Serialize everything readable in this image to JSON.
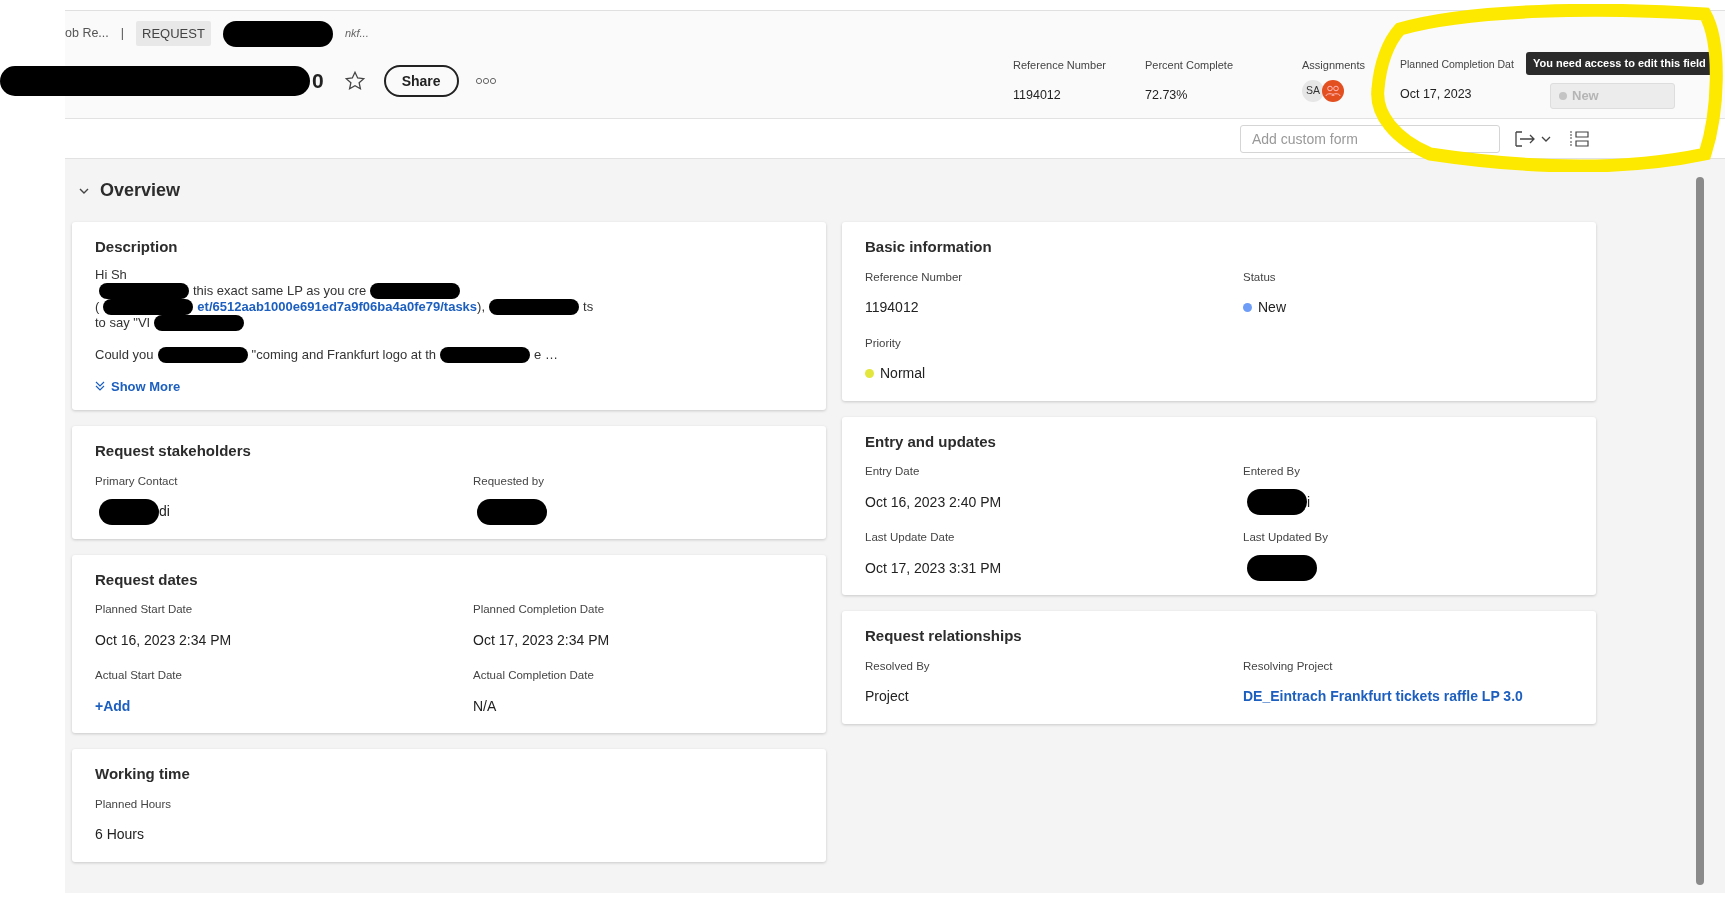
{
  "breadcrumb": {
    "parent": "ob Re...",
    "separator": "|",
    "chip": "REQUEST",
    "trail": "nkf..."
  },
  "title": {
    "visible_end": "0",
    "starred": false
  },
  "share_button": "Share",
  "summary": [
    {
      "label": "Reference Number",
      "value": "1194012"
    },
    {
      "label": "Percent Complete",
      "value": "72.73%"
    }
  ],
  "assignments": {
    "label": "Assignments",
    "avatars": [
      {
        "kind": "initials",
        "text": "SA"
      },
      {
        "kind": "team"
      }
    ]
  },
  "planned_completion": {
    "label": "Planned Completion Dat",
    "value": "Oct 17, 2023"
  },
  "status_button": {
    "label": "New",
    "disabled": true
  },
  "tooltip": "You need access to edit this field",
  "custom_form": {
    "placeholder": "Add custom form"
  },
  "section": {
    "title": "Overview",
    "expanded": true
  },
  "description": {
    "title": "Description",
    "lines": [
      [
        {
          "kind": "text",
          "text": "Hi Sh"
        }
      ],
      [
        {
          "kind": "redacted"
        },
        {
          "kind": "text",
          "text": "this exact same LP as you cre"
        },
        {
          "kind": "redacted"
        }
      ],
      [
        {
          "kind": "text",
          "text": "("
        },
        {
          "kind": "redacted"
        },
        {
          "kind": "link",
          "text": "et/6512aab1000e691ed7a9f06ba4a0fe79/tasks"
        },
        {
          "kind": "text",
          "text": "),"
        },
        {
          "kind": "redacted"
        },
        {
          "kind": "text",
          "text": "ts"
        }
      ],
      [
        {
          "kind": "text",
          "text": "to say \"VI"
        },
        {
          "kind": "redacted"
        }
      ],
      [
        {
          "kind": "text",
          "text": "Could you"
        },
        {
          "kind": "redacted"
        },
        {
          "kind": "text",
          "text": "\"coming and Frankfurt logo at th"
        },
        {
          "kind": "redacted"
        },
        {
          "kind": "text",
          "text": "e …"
        }
      ]
    ],
    "show_more": "Show More"
  },
  "cards_left": [
    {
      "title": "Request stakeholders",
      "fields": [
        {
          "label": "Primary Contact",
          "kind": "redacted",
          "value": "di"
        },
        {
          "label": "Requested by",
          "kind": "redacted"
        }
      ]
    },
    {
      "title": "Request dates",
      "fields": [
        {
          "label": "Planned Start Date",
          "kind": "text",
          "value": "Oct 16, 2023 2:34 PM"
        },
        {
          "label": "Planned Completion Date",
          "kind": "text",
          "value": "Oct 17, 2023 2:34 PM"
        },
        {
          "label": "Actual Start Date",
          "kind": "link",
          "value": "+Add"
        },
        {
          "label": "Actual Completion Date",
          "kind": "text",
          "value": "N/A"
        }
      ]
    },
    {
      "title": "Working time",
      "fields": [
        {
          "label": "Planned Hours",
          "kind": "text",
          "value": "6 Hours"
        }
      ]
    }
  ],
  "cards_right": [
    {
      "title": "Basic information",
      "fields": [
        {
          "label": "Reference Number",
          "kind": "text",
          "value": "1194012"
        },
        {
          "label": "Status",
          "kind": "dot",
          "value": "New",
          "color": "#6e9df7"
        },
        {
          "label": "Priority",
          "kind": "dot",
          "value": "Normal",
          "color": "#e3e63c"
        }
      ]
    },
    {
      "title": "Entry and updates",
      "fields": [
        {
          "label": "Entry Date",
          "kind": "text",
          "value": "Oct 16, 2023 2:40 PM"
        },
        {
          "label": "Entered By",
          "kind": "redacted",
          "value": "i"
        },
        {
          "label": "Last Update Date",
          "kind": "text",
          "value": "Oct 17, 2023 3:31 PM"
        },
        {
          "label": "Last Updated By",
          "kind": "redacted"
        }
      ]
    },
    {
      "title": "Request relationships",
      "fields": [
        {
          "label": "Resolved By",
          "kind": "text",
          "value": "Project"
        },
        {
          "label": "Resolving Project",
          "kind": "link",
          "value": "DE_Eintrach Frankfurt tickets raffle LP 3.0"
        }
      ]
    }
  ]
}
